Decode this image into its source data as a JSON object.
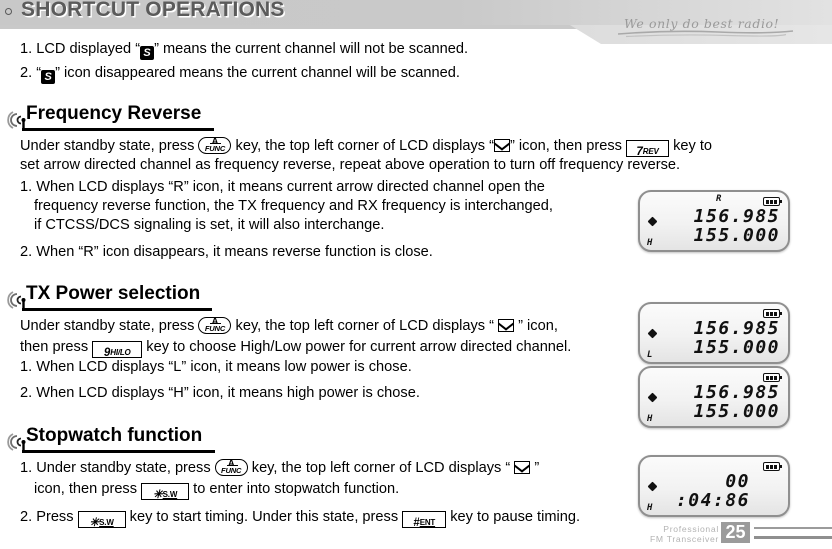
{
  "header": {
    "title": "SHORTCUT OPERATIONS",
    "tagline": "We only do best radio!"
  },
  "intro": {
    "items": [
      {
        "num": "1.",
        "pre": "LCD displayed “",
        "icon": "S",
        "post": "” means the current channel will not be scanned."
      },
      {
        "num": "2.",
        "pre": "“",
        "icon": "S",
        "post": "” icon disappeared means the current channel will be scanned."
      }
    ]
  },
  "sections": [
    {
      "id": "frequency-reverse",
      "title": "Frequency Reverse",
      "lines": [
        "Under standby state, press",
        "key, the top left corner of LCD displays “",
        "” icon, then press",
        "key to",
        "set arrow directed channel as frequency reverse, repeat above operation to turn off frequency reverse.",
        "1. When LCD displays “R” icon, it means current arrow directed channel open the",
        "frequency reverse function, the TX frequency and RX frequency is interchanged,",
        "if CTCSS/DCS signaling is set, it will also interchange.",
        "2. When “R” icon disappears, it means reverse function is close."
      ],
      "keys": [
        "A FUNC",
        "7 REV"
      ]
    },
    {
      "id": "tx-power-selection",
      "title": "TX Power selection",
      "lines": [
        "Under standby state, press",
        "key, the top left corner of LCD displays “",
        "” icon,",
        "then press",
        "key to choose High/Low power for current arrow directed channel.",
        "1. When LCD displays “L” icon, it means low power is chose.",
        "2. When LCD displays “H” icon, it means high power is chose."
      ],
      "keys": [
        "A FUNC",
        "9 HI/LO"
      ]
    },
    {
      "id": "stopwatch-function",
      "title": "Stopwatch function",
      "lines": [
        "1. Under standby state, press",
        "key, the top left corner of LCD displays “",
        "”",
        "icon, then press",
        "to enter into stopwatch function.",
        "2. Press",
        "key to start timing. Under this state, press",
        "key to pause timing."
      ],
      "keys": [
        "A FUNC",
        "* S.W",
        "# ENT"
      ]
    }
  ],
  "keys": {
    "func": {
      "main": "A",
      "sub": "FUNC"
    },
    "rev": {
      "main": "7",
      "sub": "REV"
    },
    "hilo": {
      "main": "9",
      "sub": "HI/LO"
    },
    "sw": {
      "main": "✳",
      "sub": "S.W"
    },
    "ent": {
      "main": "#",
      "sub": "ENT"
    }
  },
  "lcds": [
    {
      "id": "lcd-reverse",
      "indicator": "R",
      "line1": "156.985",
      "line2": "155.000",
      "power": "H"
    },
    {
      "id": "lcd-low-power",
      "indicator": "",
      "line1": "156.985",
      "line2": "155.000",
      "power": "L"
    },
    {
      "id": "lcd-high-power",
      "indicator": "",
      "line1": "156.985",
      "line2": "155.000",
      "power": "H"
    },
    {
      "id": "lcd-stopwatch",
      "indicator": "",
      "line1": "00",
      "line2": ":04:86",
      "power": "H"
    }
  ],
  "footer": {
    "line1": "Professional",
    "line2": "FM Transceiver",
    "page": "25"
  }
}
